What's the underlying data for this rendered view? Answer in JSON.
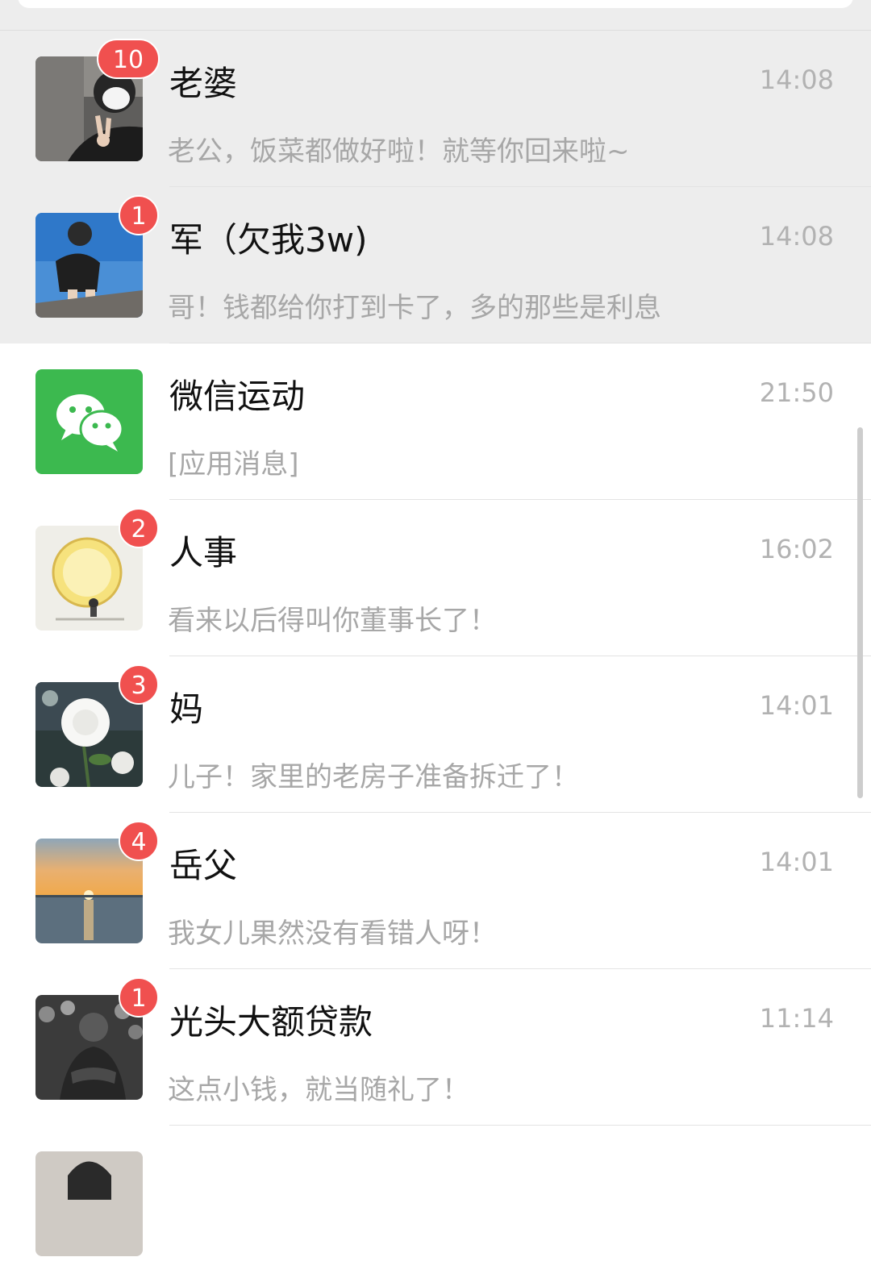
{
  "chats": [
    {
      "name": "老婆",
      "time": "14:08",
      "preview": "老公，饭菜都做好啦！就等你回来啦~",
      "badge": "10",
      "avatar": "avatar-photo-person-peace-sign-icon"
    },
    {
      "name": "军（欠我3w)",
      "time": "14:08",
      "preview": "哥！钱都给你打到卡了，多的那些是利息",
      "badge": "1",
      "avatar": "avatar-photo-person-sitting-icon"
    },
    {
      "name": "微信运动",
      "time": "21:50",
      "preview": "[应用消息]",
      "badge": "",
      "avatar": "wechat-logo-icon"
    },
    {
      "name": "人事",
      "time": "16:02",
      "preview": "看来以后得叫你董事长了！",
      "badge": "2",
      "avatar": "avatar-illustration-sun-icon"
    },
    {
      "name": "妈",
      "time": "14:01",
      "preview": "儿子！家里的老房子准备拆迁了！",
      "badge": "3",
      "avatar": "avatar-photo-white-flower-icon"
    },
    {
      "name": "岳父",
      "time": "14:01",
      "preview": "我女儿果然没有看错人呀！",
      "badge": "4",
      "avatar": "avatar-photo-sunset-sea-icon"
    },
    {
      "name": "光头大额贷款",
      "time": "11:14",
      "preview": "这点小钱，就当随礼了！",
      "badge": "1",
      "avatar": "avatar-photo-crowd-icon"
    }
  ],
  "colors": {
    "badge": "#f0504f",
    "wechat_green": "#3cb94f",
    "pinned_bg": "#ededed"
  }
}
